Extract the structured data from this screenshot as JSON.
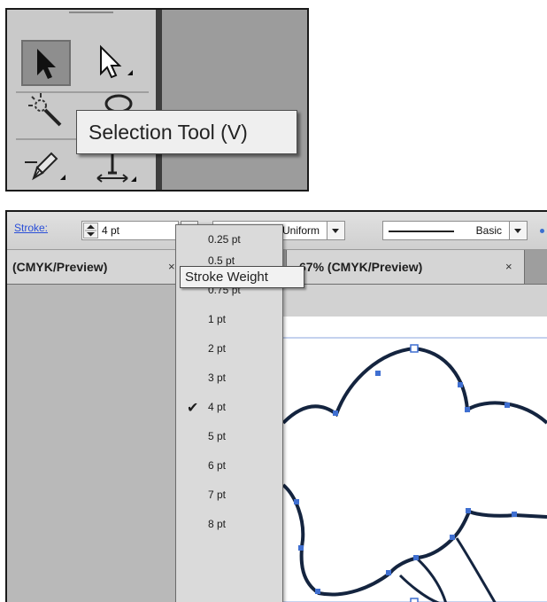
{
  "tools_panel": {
    "tooltip": "Selection Tool (V)",
    "icons": [
      "selection-tool-icon",
      "direct-selection-tool-icon",
      "magic-wand-tool-icon",
      "lasso-tool-icon",
      "pen-tool-icon",
      "type-tool-icon"
    ]
  },
  "control_bar": {
    "stroke_label": "Stroke:",
    "weight_value": "4 pt",
    "profile_label": "Uniform",
    "brush_label": "Basic"
  },
  "tabs": [
    {
      "label": "(CMYK/Preview)",
      "close": "×"
    },
    {
      "label": "67% (CMYK/Preview)",
      "close": "×"
    }
  ],
  "weight_menu": {
    "tooltip": "Stroke Weight",
    "selected": "4 pt",
    "items": [
      "0.25 pt",
      "0.5 pt",
      "0.75 pt",
      "1 pt",
      "2 pt",
      "3 pt",
      "4 pt",
      "5 pt",
      "6 pt",
      "7 pt",
      "8 pt"
    ],
    "check_symbol": "✔"
  },
  "colors": {
    "toolbar": "#c9c9c9",
    "canvas_bg": "#9c9c9c",
    "link": "#2a4fd8",
    "path_stroke": "#14243f",
    "anchor": "#3f6fd1"
  }
}
